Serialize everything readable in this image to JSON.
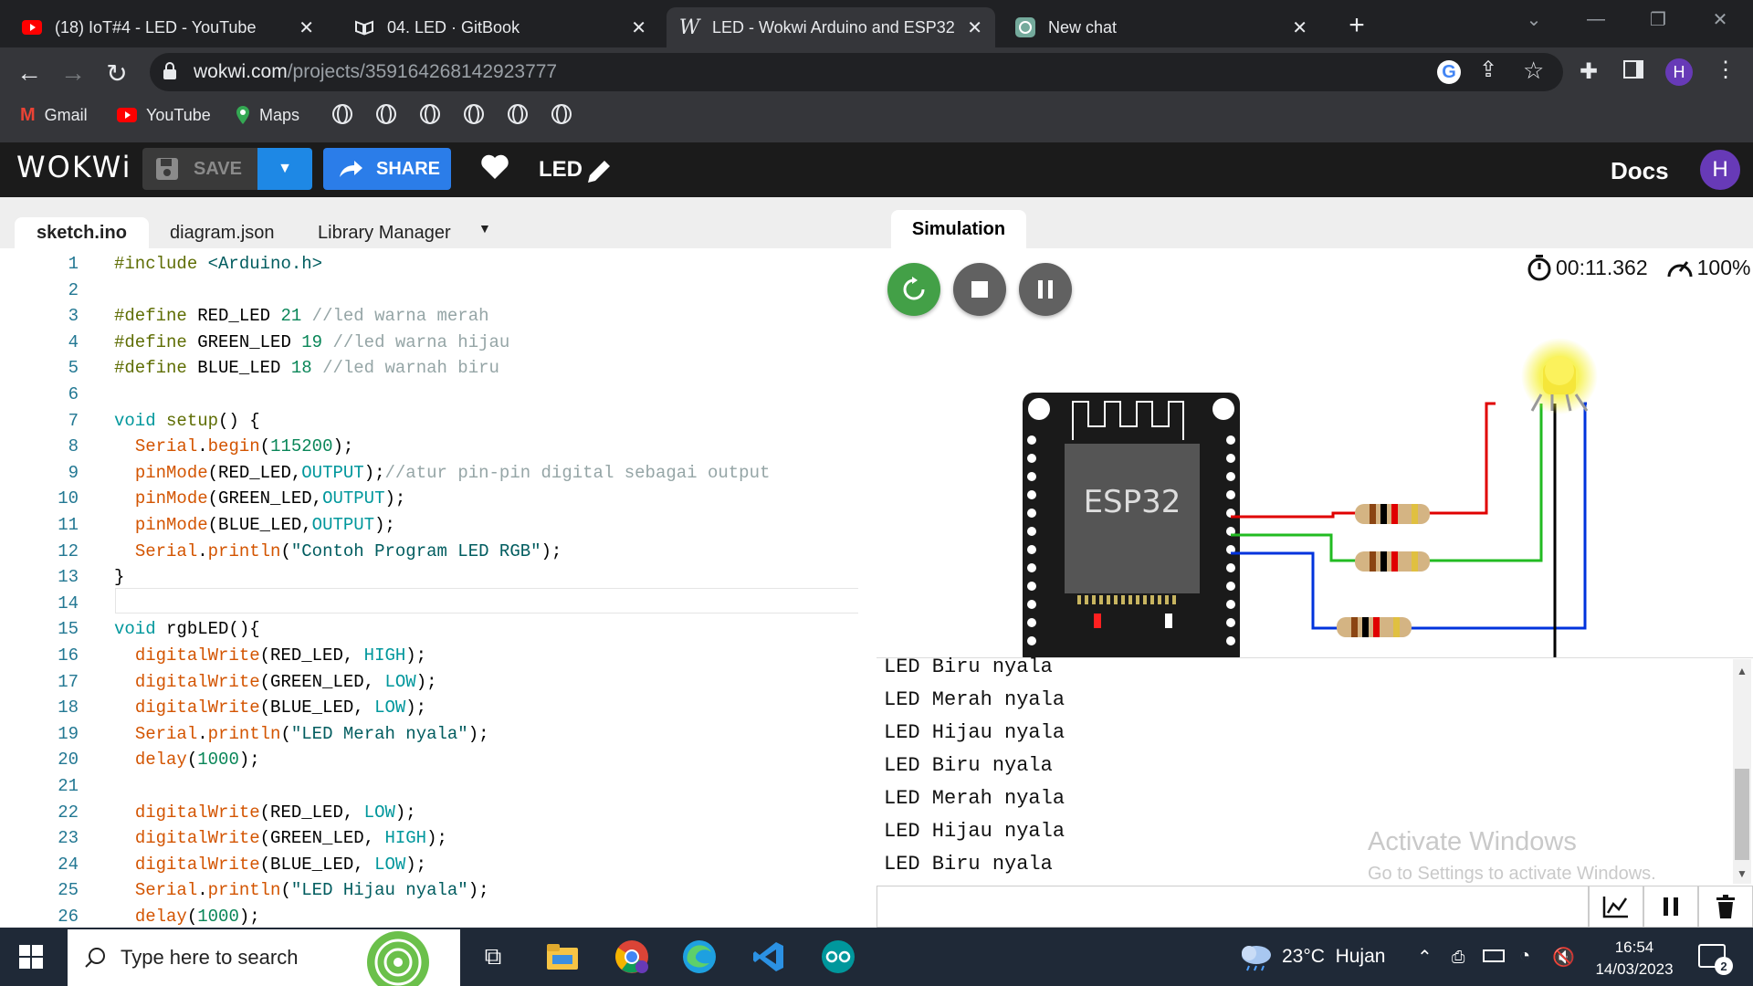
{
  "browser": {
    "tabs": [
      {
        "title": "(18) IoT#4 - LED - YouTube",
        "icon": "youtube-icon"
      },
      {
        "title": "04. LED · GitBook",
        "icon": "gitbook-icon"
      },
      {
        "title": "LED - Wokwi Arduino and ESP32",
        "icon": "wokwi-icon"
      },
      {
        "title": "New chat",
        "icon": "chatgpt-icon"
      }
    ],
    "url_domain": "wokwi.com",
    "url_path": "/projects/359164268142923777",
    "profile_initial": "H",
    "bookmarks": [
      "Gmail",
      "YouTube",
      "Maps"
    ]
  },
  "wokwi": {
    "logo": "WOKWi",
    "save_label": "SAVE",
    "share_label": "SHARE",
    "project_name": "LED",
    "docs_label": "Docs",
    "user_initial": "H"
  },
  "editor": {
    "tabs": [
      "sketch.ino",
      "diagram.json",
      "Library Manager"
    ]
  },
  "simulation": {
    "tab_label": "Simulation",
    "timer": "00:11.362",
    "speed": "100%",
    "chip_label": "ESP32"
  },
  "serial_output": [
    "LED Biru nyala",
    "LED Merah nyala",
    "LED Hijau nyala",
    "LED Biru nyala",
    "LED Merah nyala",
    "LED Hijau nyala",
    "LED Biru nyala"
  ],
  "watermark": {
    "title": "Activate Windows",
    "subtitle": "Go to Settings to activate Windows."
  },
  "taskbar": {
    "search_placeholder": "Type here to search",
    "weather": "23°C  Hujan",
    "time": "16:54",
    "date": "14/03/2023",
    "notif_count": "2"
  },
  "colors": {
    "wokwi_bar": "#1b1b1b",
    "share_blue": "#2b7de9",
    "save_blue": "#1e88e5",
    "play_green": "#43a047",
    "user_purple": "#673ab7"
  }
}
